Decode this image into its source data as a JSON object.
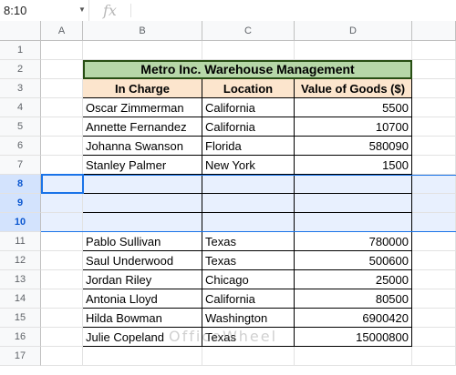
{
  "formula_bar": {
    "name_box": "8:10",
    "fx_label": "fx",
    "formula": ""
  },
  "columns": [
    "A",
    "B",
    "C",
    "D"
  ],
  "rows": [
    "1",
    "2",
    "3",
    "4",
    "5",
    "6",
    "7",
    "8",
    "9",
    "10",
    "11",
    "12",
    "13",
    "14",
    "15",
    "16",
    "17"
  ],
  "title": "Metro Inc. Warehouse Management",
  "headers": [
    "In Charge",
    "Location",
    "Value of Goods ($)"
  ],
  "records_top": [
    [
      "Oscar Zimmerman",
      "California",
      "5500"
    ],
    [
      "Annette Fernandez",
      "California",
      "10700"
    ],
    [
      "Johanna Swanson",
      "Florida",
      "580090"
    ],
    [
      "Stanley Palmer",
      "New York",
      "1500"
    ]
  ],
  "records_bottom": [
    [
      "Pablo Sullivan",
      "Texas",
      "780000"
    ],
    [
      "Saul Underwood",
      "Texas",
      "500600"
    ],
    [
      "Jordan Riley",
      "Chicago",
      "25000"
    ],
    [
      "Antonia Lloyd",
      "California",
      "80500"
    ],
    [
      "Hilda Bowman",
      "Washington",
      "6900420"
    ],
    [
      "Julie Copeland",
      "Texas",
      "15000800"
    ]
  ],
  "selected_rows": [
    "8",
    "9",
    "10"
  ],
  "watermark": "OfficeWheel",
  "colors": {
    "title_fill": "#b6d7a8",
    "header_fill": "#fce5cd",
    "selection": "#e8f0fe",
    "accent": "#1a73e8"
  }
}
